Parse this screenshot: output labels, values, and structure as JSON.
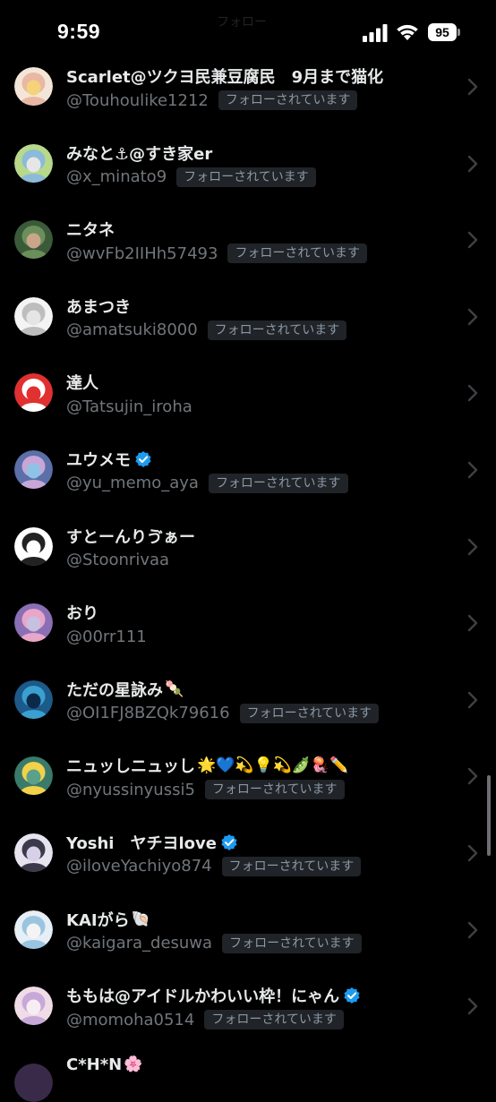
{
  "status_bar": {
    "time": "9:59",
    "battery": "95",
    "ghost_title": "フォロー"
  },
  "badge_text": "フォローされています",
  "users": [
    {
      "name": "Scarlet@ツクヨ民兼豆腐民　9月まで猫化",
      "handle": "@Touhoulike1212",
      "follows_you": true,
      "verified": false,
      "emoji": "",
      "avatar_colors": [
        "#f3e6d8",
        "#e8b8a4",
        "#f6d27a"
      ]
    },
    {
      "name": "みなと⚓@すき家er",
      "handle": "@x_minato9",
      "follows_you": true,
      "verified": false,
      "emoji": "",
      "avatar_colors": [
        "#b8d88a",
        "#8bbbd9",
        "#e6e6e6"
      ]
    },
    {
      "name": "ニタネ",
      "handle": "@wvFb2IIHh57493",
      "follows_you": true,
      "verified": false,
      "emoji": "",
      "avatar_colors": [
        "#3b5a3a",
        "#6b8f5a",
        "#caa58a"
      ]
    },
    {
      "name": "あまつき",
      "handle": "@amatsuki8000",
      "follows_you": true,
      "verified": false,
      "emoji": "",
      "avatar_colors": [
        "#f4f4f4",
        "#bdbdbd",
        "#e5e5e5"
      ]
    },
    {
      "name": "達人",
      "handle": "@Tatsujin_iroha",
      "follows_you": false,
      "verified": false,
      "emoji": "",
      "avatar_colors": [
        "#e03030",
        "#ffffff",
        "#e03030"
      ]
    },
    {
      "name": "ユウメモ",
      "handle": "@yu_memo_aya",
      "follows_you": true,
      "verified": true,
      "emoji": "",
      "avatar_colors": [
        "#5b6fa8",
        "#c9a6d8",
        "#8ec3e6"
      ]
    },
    {
      "name": "すとーんりゔぁー",
      "handle": "@Stoonrivaa",
      "follows_you": false,
      "verified": false,
      "emoji": "",
      "avatar_colors": [
        "#ffffff",
        "#222222",
        "#ffffff"
      ]
    },
    {
      "name": "おり",
      "handle": "@00rr111",
      "follows_you": false,
      "verified": false,
      "emoji": "",
      "avatar_colors": [
        "#8a6fb5",
        "#e8a6c8",
        "#c7c0e0"
      ]
    },
    {
      "name": "ただの星詠み",
      "handle": "@OI1FJ8BZQk79616",
      "follows_you": true,
      "verified": false,
      "emoji": "🍡",
      "avatar_colors": [
        "#1c5a8a",
        "#3aa0d0",
        "#0b2a4a"
      ]
    },
    {
      "name": "ニュッしニュッし",
      "handle": "@nyussinyussi5",
      "follows_you": true,
      "verified": false,
      "emoji": "🌟💙💫💡💫🫛🪼✏️",
      "avatar_colors": [
        "#3a7a6a",
        "#f2d24a",
        "#5aa08a"
      ]
    },
    {
      "name": "Yoshi　ヤチヨlove",
      "handle": "@iloveYachiyo874",
      "follows_you": true,
      "verified": true,
      "emoji": "",
      "avatar_colors": [
        "#e8e4ef",
        "#3a3a4a",
        "#d8d0e8"
      ]
    },
    {
      "name": "KAIがら",
      "handle": "@kaigara_desuwa",
      "follows_you": true,
      "verified": false,
      "emoji": "🐚",
      "avatar_colors": [
        "#e6eef6",
        "#9ac4e0",
        "#f4f4f4"
      ]
    },
    {
      "name": "ももは@アイドルかわいい枠！にゃん",
      "handle": "@momoha0514",
      "follows_you": true,
      "verified": true,
      "emoji": "",
      "avatar_colors": [
        "#f0dce6",
        "#c8a8d8",
        "#f6eef2"
      ]
    }
  ],
  "partial_user": {
    "name": "C*H*N",
    "emoji": "🌸"
  },
  "colors": {
    "background": "#000000",
    "name": "#e7e9ea",
    "handle": "#71767b",
    "badge_bg": "#202327",
    "badge_text": "#8b98a5",
    "verified": "#1d9bf0",
    "chevron": "#3e4144"
  }
}
